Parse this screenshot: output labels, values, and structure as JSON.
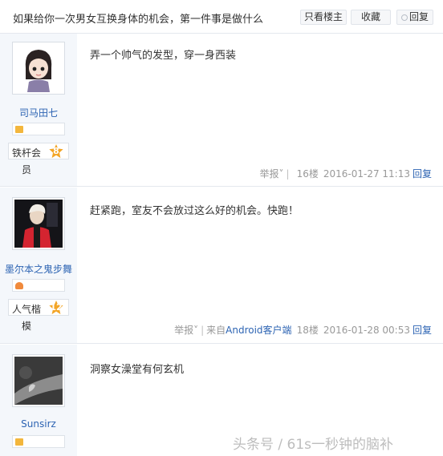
{
  "thread": {
    "title": "如果给你一次男女互换身体的机会，第一件事是做什么",
    "buttons": {
      "only_op": "只看楼主",
      "favorite": "收藏",
      "reply": "回复"
    }
  },
  "posts": [
    {
      "username": "司马田七",
      "badge_name": "铁杆会",
      "badge_tail": "员",
      "badge_level": "8",
      "content": "弄一个帅气的发型，穿一身西装",
      "report": "举报",
      "source": "",
      "floor": "16楼",
      "time": "2016-01-27 11:13",
      "reply": "回复",
      "avatar_icon": "cartoon-girl-avatar"
    },
    {
      "username": "墨尔本之鬼步舞",
      "badge_name": "人气楷",
      "badge_tail": "模",
      "badge_level": "12",
      "content": "赶紧跑，室友不会放过这么好的机会。快跑！",
      "report": "举报",
      "source_prefix": "来自",
      "source_link": "Android客户端",
      "floor": "18楼",
      "time": "2016-01-28 00:53",
      "reply": "回复",
      "avatar_icon": "person-red-jacket-avatar"
    },
    {
      "username": "Sunsirz",
      "content": "洞察女澡堂有何玄机",
      "avatar_icon": "wrist-bracelet-avatar"
    }
  ],
  "watermark": "头条号 / 61s一秒钟的脑补",
  "colors": {
    "link": "#2d64b3",
    "side_bg": "#f4f7fb",
    "badge": "#f3a526"
  }
}
